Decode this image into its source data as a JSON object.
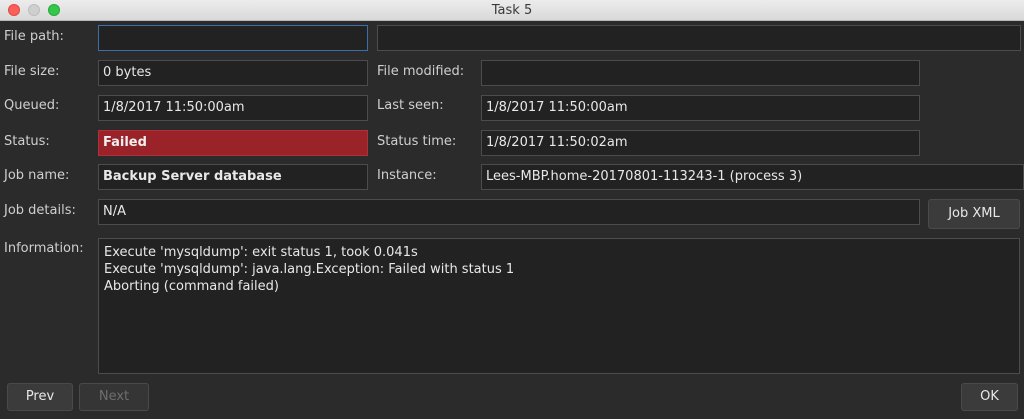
{
  "window": {
    "title": "Task 5"
  },
  "fields": {
    "file_path": {
      "label": "File path:",
      "value": "",
      "secondary_value": ""
    },
    "file_size": {
      "label": "File size:",
      "value": "0 bytes"
    },
    "file_modified": {
      "label": "File modified:",
      "value": ""
    },
    "queued": {
      "label": "Queued:",
      "value": "1/8/2017 11:50:00am"
    },
    "last_seen": {
      "label": "Last seen:",
      "value": "1/8/2017 11:50:00am"
    },
    "status": {
      "label": "Status:",
      "value": "Failed",
      "color": "#9a2329"
    },
    "status_time": {
      "label": "Status time:",
      "value": "1/8/2017 11:50:02am"
    },
    "job_name": {
      "label": "Job name:",
      "value": "Backup Server database"
    },
    "instance": {
      "label": "Instance:",
      "value": "Lees-MBP.home-20170801-113243-1 (process 3)"
    },
    "job_details": {
      "label": "Job details:",
      "value": "N/A"
    },
    "information": {
      "label": "Information:",
      "lines": [
        "Execute 'mysqldump': exit status 1, took 0.041s",
        "Execute 'mysqldump': java.lang.Exception: Failed with status 1",
        "Aborting (command failed)"
      ]
    }
  },
  "buttons": {
    "job_xml": "Job XML",
    "prev": "Prev",
    "next": "Next",
    "ok": "OK"
  }
}
